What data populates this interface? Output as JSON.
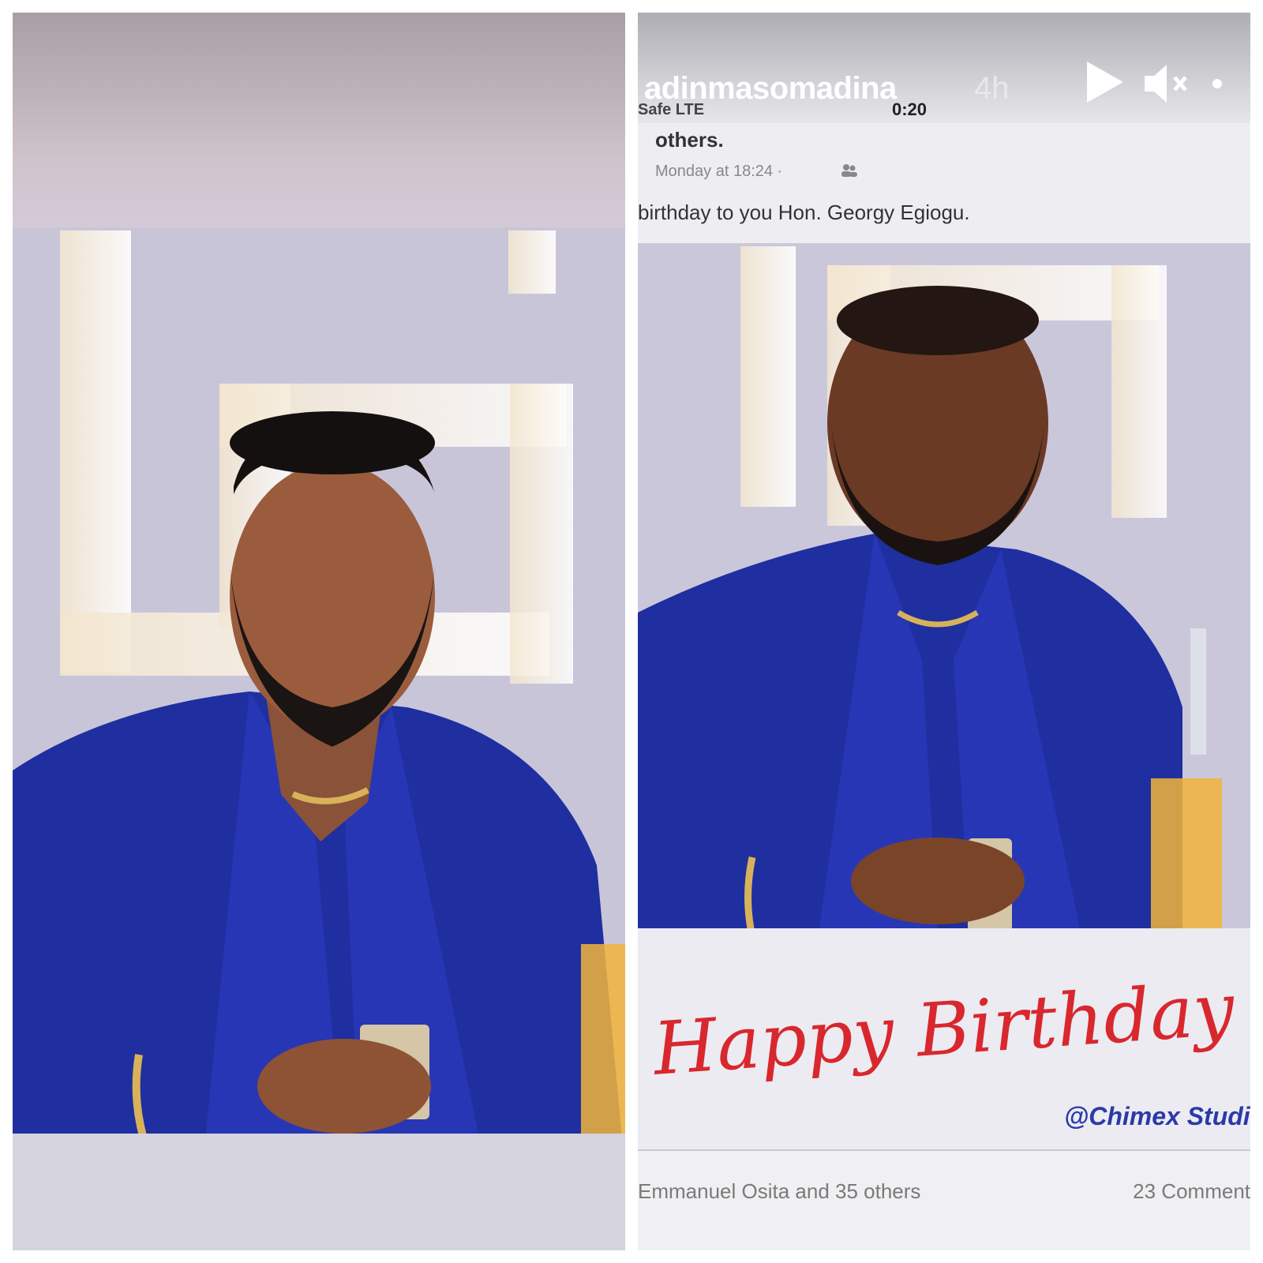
{
  "story": {
    "username": "adinmasomadina",
    "time_ago": "4h",
    "icons": [
      "play-icon",
      "mute-icon",
      "more-icon"
    ]
  },
  "screenshot": {
    "carrier": "Safe  LTE",
    "clock": "0:20",
    "names_suffix": "others.",
    "date": "Monday at 18:24 ·",
    "caption": "birthday to you Hon. Georgy Egiogu.",
    "greeting": "Happy Birthday",
    "watermark": "@Chimex Studi",
    "likes": "Emmanuel Osita and 35 others",
    "comments": "23 Comment"
  },
  "colors": {
    "jacket_blue": "#1f2fa0",
    "greeting_red": "#d9272e",
    "watermark_blue": "#2b3aa8"
  }
}
